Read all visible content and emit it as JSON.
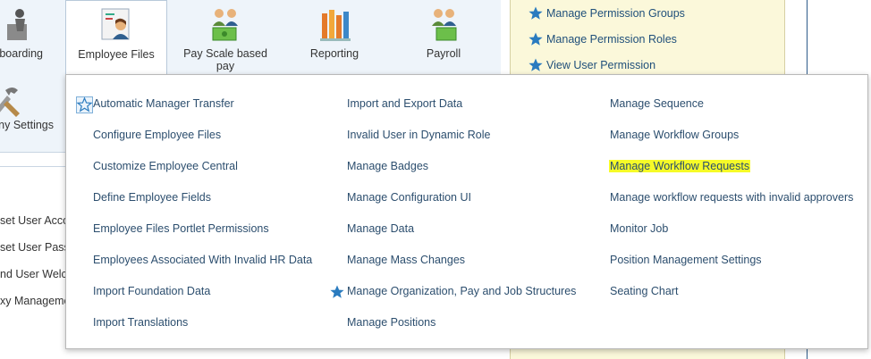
{
  "tiles": [
    {
      "label": "boarding",
      "icon": "onboarding-icon",
      "selected": false
    },
    {
      "label": "Employee Files",
      "icon": "employee-files-icon",
      "selected": true
    },
    {
      "label": "Pay Scale based pay",
      "icon": "pay-scale-icon",
      "selected": false
    },
    {
      "label": "Reporting",
      "icon": "reporting-icon",
      "selected": false
    },
    {
      "label": "Payroll",
      "icon": "payroll-icon",
      "selected": false
    }
  ],
  "second_row_tile": {
    "label": "ny Settings",
    "icon": "company-settings-icon"
  },
  "side_links": [
    "set User Acco",
    "set User Pass",
    "nd User Welco",
    "xy Manageme"
  ],
  "permission_links": [
    "Manage Permission Groups",
    "Manage Permission Roles",
    "View User Permission"
  ],
  "menu": {
    "columns": [
      [
        {
          "label": "Automatic Manager Transfer",
          "starred": false,
          "star_outline": true
        },
        {
          "label": "Configure Employee Files"
        },
        {
          "label": "Customize Employee Central"
        },
        {
          "label": "Define Employee Fields"
        },
        {
          "label": "Employee Files Portlet Permissions"
        },
        {
          "label": "Employees Associated With Invalid HR Data"
        },
        {
          "label": "Import Foundation Data"
        },
        {
          "label": "Import Translations"
        }
      ],
      [
        {
          "label": "Import and Export Data"
        },
        {
          "label": "Invalid User in Dynamic Role"
        },
        {
          "label": "Manage Badges"
        },
        {
          "label": "Manage Configuration UI"
        },
        {
          "label": "Manage Data"
        },
        {
          "label": "Manage Mass Changes"
        },
        {
          "label": "Manage Organization, Pay and Job Structures",
          "starred": true
        },
        {
          "label": "Manage Positions"
        }
      ],
      [
        {
          "label": "Manage Sequence"
        },
        {
          "label": "Manage Workflow Groups"
        },
        {
          "label": "Manage Workflow Requests",
          "highlighted": true
        },
        {
          "label": "Manage workflow requests with invalid approvers"
        },
        {
          "label": "Monitor Job"
        },
        {
          "label": "Position Management Settings"
        },
        {
          "label": "Seating Chart"
        }
      ]
    ]
  },
  "colors": {
    "link": "#2c4e6e",
    "star": "#2a7bbf",
    "highlight": "#f6fb28",
    "panel_yellow": "#fbf8da"
  }
}
